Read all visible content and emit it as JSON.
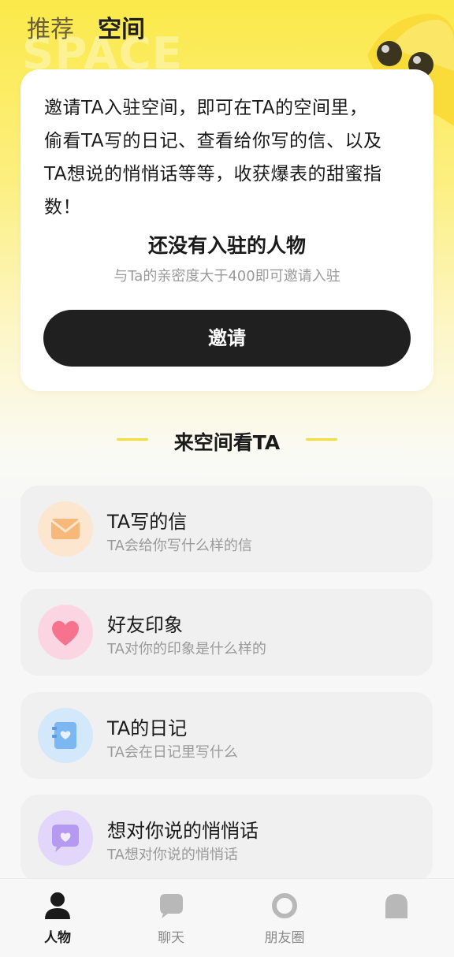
{
  "header": {
    "tabs": [
      {
        "label": "推荐",
        "active": false
      },
      {
        "label": "空间",
        "active": true
      }
    ],
    "watermark": "SPACE"
  },
  "intro": {
    "lines": [
      "邀请TA入驻空间，即可在TA的空间里，",
      "偷看TA写的日记、查看给你写的信、以及",
      "TA想说的悄悄话等等，收获爆表的甜蜜指",
      "数！"
    ],
    "empty_title": "还没有入驻的人物",
    "empty_subtitle": "与Ta的亲密度大于400即可邀请入驻",
    "invite_label": "邀请"
  },
  "section": {
    "title": "来空间看TA"
  },
  "features": [
    {
      "title": "TA写的信",
      "subtitle": "TA会给你写什么样的信",
      "icon": "envelope-icon"
    },
    {
      "title": "好友印象",
      "subtitle": "TA对你的印象是什么样的",
      "icon": "heart-icon"
    },
    {
      "title": "TA的日记",
      "subtitle": "TA会在日记里写什么",
      "icon": "diary-icon"
    },
    {
      "title": "想对你说的悄悄话",
      "subtitle": "TA想对你说的悄悄话",
      "icon": "chat-heart-icon"
    }
  ],
  "nav": [
    {
      "label": "人物",
      "icon": "person-icon",
      "active": true
    },
    {
      "label": "聊天",
      "icon": "chat-bubble-icon",
      "active": false
    },
    {
      "label": "朋友圈",
      "icon": "ring-icon",
      "active": false
    },
    {
      "label": "",
      "icon": "profile-icon",
      "active": false
    }
  ],
  "colors": {
    "accent_yellow": "#fbe94a",
    "button_dark": "#202020"
  }
}
